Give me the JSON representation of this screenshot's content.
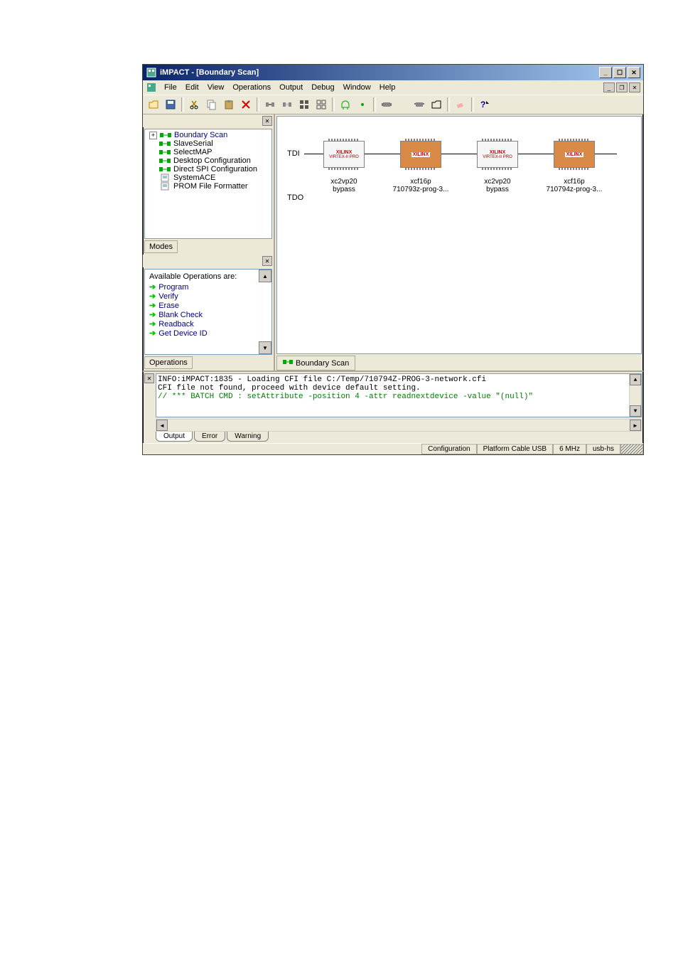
{
  "window": {
    "title": "iMPACT - [Boundary Scan]"
  },
  "menu": {
    "file": "File",
    "edit": "Edit",
    "view": "View",
    "operations": "Operations",
    "output": "Output",
    "debug": "Debug",
    "windowm": "Window",
    "help": "Help"
  },
  "tree": {
    "boundary_scan": "Boundary Scan",
    "slave_serial": "SlaveSerial",
    "select_map": "SelectMAP",
    "desktop_config": "Desktop Configuration",
    "direct_spi": "Direct SPI Configuration",
    "system_ace": "SystemACE",
    "prom_formatter": "PROM File Formatter"
  },
  "modes_tab": "Modes",
  "operations_pane": {
    "header": "Available Operations are:",
    "items": {
      "program": "Program",
      "verify": "Verify",
      "erase": "Erase",
      "blank_check": "Blank Check",
      "readback": "Readback",
      "get_id": "Get Device ID"
    },
    "tab": "Operations"
  },
  "chain": {
    "tdi": "TDI",
    "tdo": "TDO",
    "chip_brand": "XILINX",
    "fpga_sub": "VIRTEX-II PRO",
    "devices": [
      {
        "name": "xc2vp20",
        "file": "bypass",
        "type": "fpga"
      },
      {
        "name": "xcf16p",
        "file": "710793z-prog-3...",
        "type": "prom"
      },
      {
        "name": "xc2vp20",
        "file": "bypass",
        "type": "fpga"
      },
      {
        "name": "xcf16p",
        "file": "710794z-prog-3...",
        "type": "prom"
      }
    ]
  },
  "view_tab": "Boundary Scan",
  "console": {
    "line1": "INFO:iMPACT:1835 - Loading CFI file C:/Temp/710794Z-PROG-3-network.cfi",
    "line2": "CFI file not found, proceed with device default setting.",
    "line3": "// *** BATCH CMD : setAttribute -position 4 -attr readnextdevice -value \"(null)\"",
    "tabs": {
      "output": "Output",
      "error": "Error",
      "warning": "Warning"
    }
  },
  "status": {
    "config": "Configuration",
    "cable": "Platform Cable USB",
    "speed": "6 MHz",
    "port": "usb-hs"
  }
}
